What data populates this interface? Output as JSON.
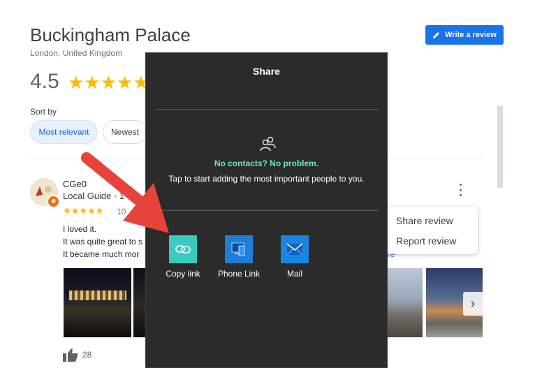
{
  "place": {
    "title": "Buckingham Palace",
    "location": "London, United Kingdom",
    "rating": "4.5",
    "stars": "★★★★★",
    "write_review_label": "Write a review"
  },
  "sort": {
    "label": "Sort by",
    "options": [
      "Most relevant",
      "Newest"
    ],
    "selected": "Most relevant"
  },
  "review": {
    "author": "CGe0",
    "author_meta": "Local Guide · 1",
    "stars": "★★★★★",
    "count_partial": "10",
    "lines": [
      "I loved it.",
      "It was quite great to s",
      "It became much mor"
    ],
    "more_label": "ore",
    "likes": "28"
  },
  "review_menu": {
    "items": [
      "Share review",
      "Report review"
    ]
  },
  "share_dialog": {
    "title": "Share",
    "no_contacts_heading": "No contacts? No problem.",
    "no_contacts_text": "Tap to start adding the most important people to you.",
    "apps": [
      {
        "label": "Copy link",
        "icon": "link-icon"
      },
      {
        "label": "Phone Link",
        "icon": "phone-link-icon"
      },
      {
        "label": "Mail",
        "icon": "mail-icon"
      }
    ]
  },
  "colors": {
    "accent": "#1a73e8",
    "star": "#fbbc04",
    "dialog_bg": "#2b2b2b",
    "teal": "#6ee2d6",
    "arrow": "#e8433a"
  }
}
